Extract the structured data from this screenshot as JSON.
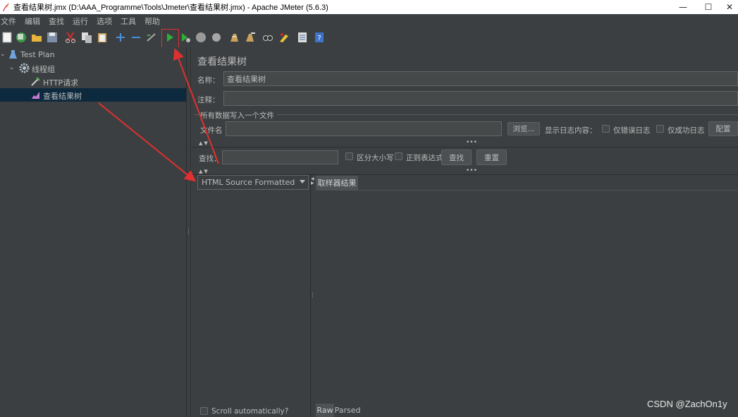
{
  "window": {
    "title": "查看结果树.jmx (D:\\AAA_Programme\\Tools\\Jmeter\\查看结果树.jmx) - Apache JMeter (5.6.3)",
    "minimize": "—",
    "maximize": "☐",
    "close": "✕"
  },
  "menu": [
    "文件",
    "编辑",
    "查找",
    "运行",
    "选项",
    "工具",
    "帮助"
  ],
  "toolbar_icons": [
    "new-icon",
    "templates-icon",
    "open-icon",
    "save-icon",
    "cut-icon",
    "copy-icon",
    "paste-icon",
    "expand-icon",
    "collapse-icon",
    "toggle-icon",
    "start-icon",
    "start-no-pause-icon",
    "stop-icon",
    "shutdown-icon",
    "clear-icon",
    "clear-all-icon",
    "search-icon",
    "reset-search-icon",
    "function-helper-icon",
    "help-icon"
  ],
  "tree": {
    "items": [
      {
        "label": "Test Plan",
        "icon": "test-plan-icon"
      },
      {
        "label": "线程组",
        "icon": "thread-group-gear-icon"
      },
      {
        "label": "HTTP请求",
        "icon": "http-sampler-icon"
      },
      {
        "label": "查看结果树",
        "icon": "view-results-tree-icon"
      }
    ]
  },
  "panel": {
    "title": "查看结果树",
    "name_label": "名称：",
    "name_value": "查看结果树",
    "comment_label": "注释：",
    "comment_value": "",
    "file_section_label": "所有数据写入一个文件",
    "filename_label": "文件名",
    "filename_value": "",
    "browse_button": "浏览...",
    "log_content_label": "显示日志内容：",
    "errors_only_label": "仅错误日志",
    "success_only_label": "仅成功日志",
    "configure_button": "配置",
    "search_label": "查找：",
    "search_value": "",
    "case_sensitive_label": "区分大小写",
    "regex_label": "正则表达式",
    "find_button": "查找",
    "reset_button": "重置",
    "renderer_selected": "HTML Source Formatted",
    "sampler_result_tab": "取样器结果",
    "scroll_auto_label": "Scroll automatically?",
    "raw_tab": "Raw",
    "parsed_tab": "Parsed"
  },
  "colors": {
    "background": "#3c3f41",
    "selection": "#0d293e",
    "annotation": "#e03030"
  },
  "watermark": "CSDN @ZachOn1y"
}
